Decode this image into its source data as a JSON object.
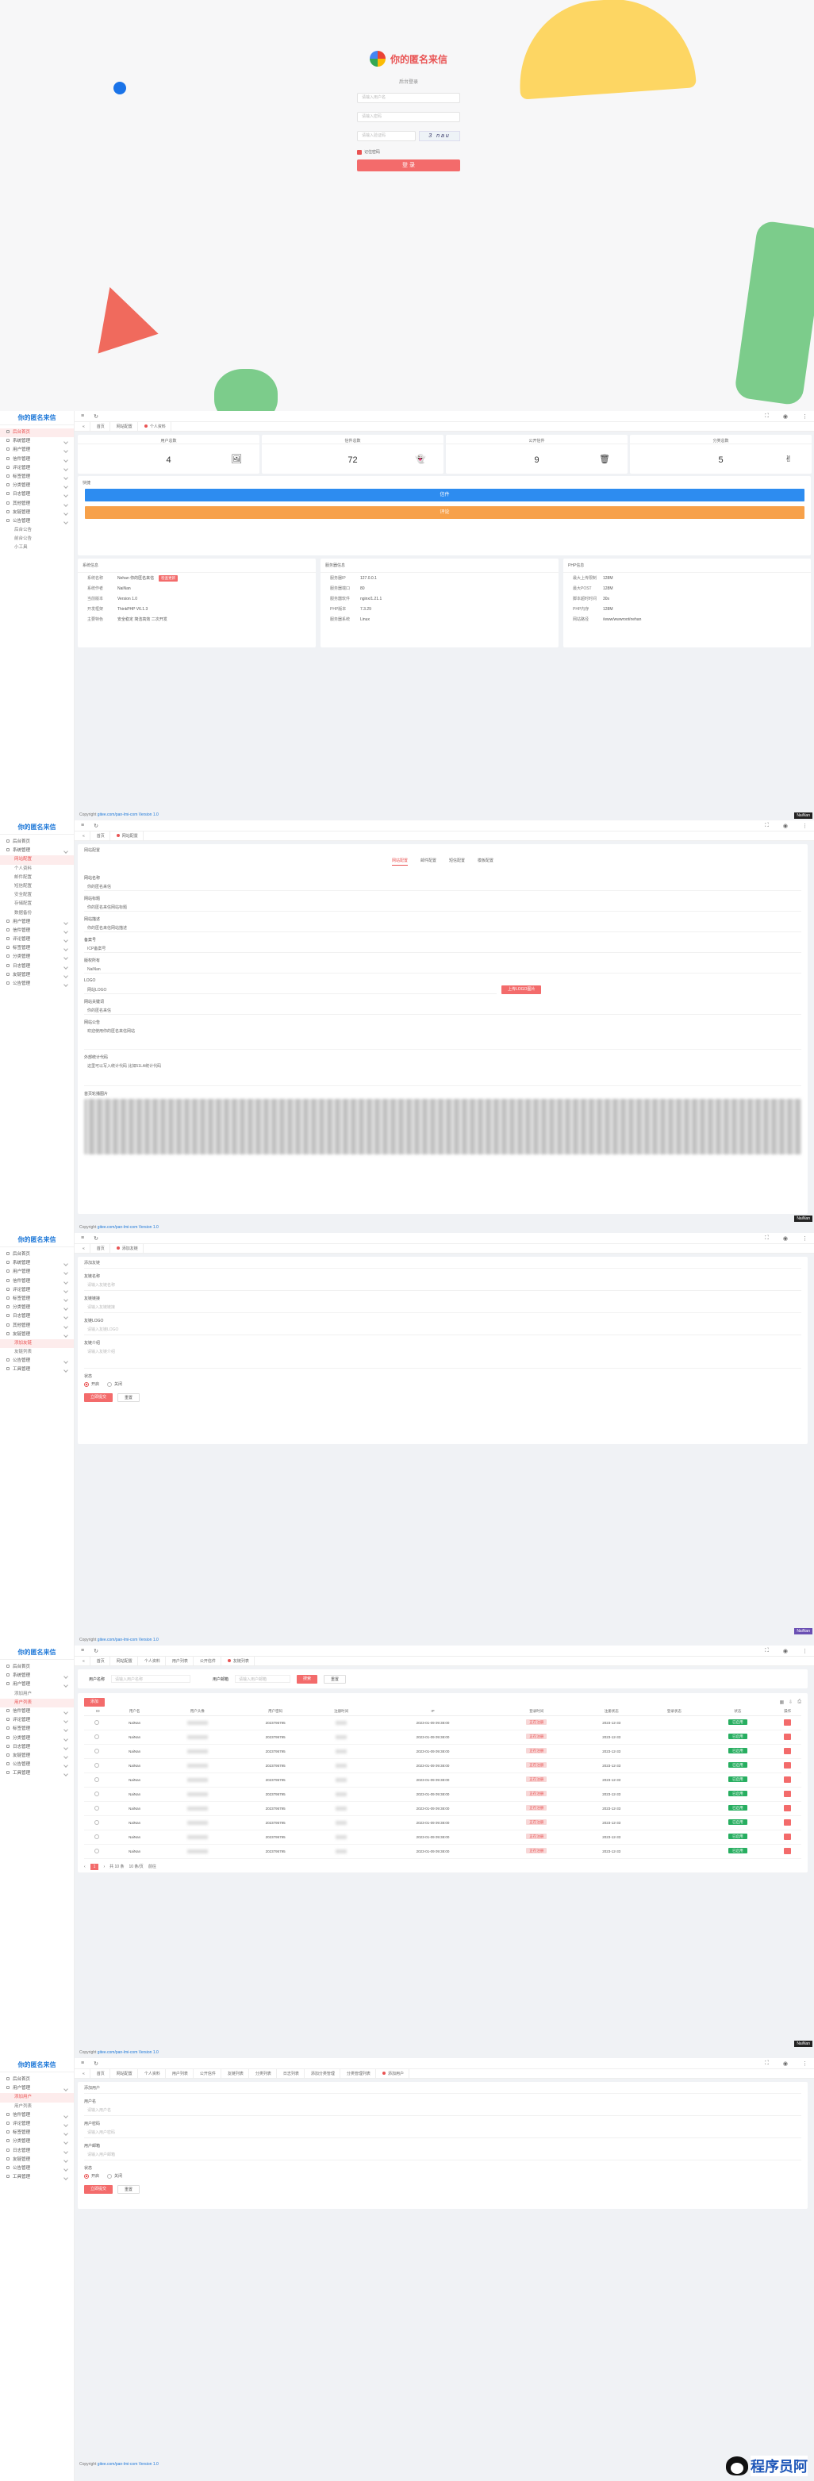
{
  "app": {
    "brand": "你的匿名来信",
    "copyright_prefix": "Copyright",
    "copyright_link": "gitee.com/pan-lmi-com",
    "copyright_version": "Version 1.0"
  },
  "login": {
    "title": "你的匿名来信",
    "subtitle": "后台登录",
    "username_placeholder": "请输入用户名",
    "password_placeholder": "请输入密码",
    "captcha_placeholder": "请输入验证码",
    "captcha_text": "3 nau",
    "remember": "记住密码",
    "submit": "登 录"
  },
  "menu_dashboard": [
    {
      "label": "后台首页",
      "active": true
    },
    {
      "label": "系统管理",
      "open": true
    },
    {
      "label": "用户管理",
      "open": true
    },
    {
      "label": "信件管理",
      "open": true
    },
    {
      "label": "评论管理",
      "open": true
    },
    {
      "label": "标签管理",
      "open": true
    },
    {
      "label": "分类管理",
      "open": true
    },
    {
      "label": "日志管理",
      "open": true
    },
    {
      "label": "其他管理",
      "open": true
    },
    {
      "label": "友链管理",
      "open": true
    },
    {
      "label": "公告管理",
      "open": true
    },
    {
      "label": "后台公告",
      "sub": true
    },
    {
      "label": "前台公告",
      "sub": true
    },
    {
      "label": "小工具",
      "sub": true
    }
  ],
  "menu_settings": [
    {
      "label": "后台首页"
    },
    {
      "label": "系统管理",
      "open": true
    },
    {
      "label": "网站配置",
      "sub": true,
      "active": true
    },
    {
      "label": "个人资料",
      "sub": true
    },
    {
      "label": "邮件配置",
      "sub": true
    },
    {
      "label": "短信配置",
      "sub": true
    },
    {
      "label": "安全配置",
      "sub": true
    },
    {
      "label": "存储配置",
      "sub": true
    },
    {
      "label": "数据备份",
      "sub": true
    },
    {
      "label": "用户管理",
      "open": true
    },
    {
      "label": "信件管理",
      "open": true
    },
    {
      "label": "评论管理",
      "open": true
    },
    {
      "label": "标签管理",
      "open": true
    },
    {
      "label": "分类管理",
      "open": true
    },
    {
      "label": "日志管理",
      "open": true
    },
    {
      "label": "友链管理",
      "open": true
    },
    {
      "label": "公告管理",
      "open": true
    }
  ],
  "menu_addlink": [
    {
      "label": "后台首页"
    },
    {
      "label": "系统管理",
      "open": true
    },
    {
      "label": "用户管理",
      "open": true
    },
    {
      "label": "信件管理",
      "open": true
    },
    {
      "label": "评论管理",
      "open": true
    },
    {
      "label": "标签管理",
      "open": true
    },
    {
      "label": "分类管理",
      "open": true
    },
    {
      "label": "日志管理",
      "open": true
    },
    {
      "label": "其他管理",
      "open": true
    },
    {
      "label": "友链管理",
      "open": true
    },
    {
      "label": "添加友链",
      "sub": true,
      "active": true
    },
    {
      "label": "友链列表",
      "sub": true
    },
    {
      "label": "公告管理",
      "open": true
    },
    {
      "label": "工具管理",
      "open": true
    }
  ],
  "menu_users": [
    {
      "label": "后台首页"
    },
    {
      "label": "系统管理",
      "open": true
    },
    {
      "label": "用户管理",
      "open": true
    },
    {
      "label": "添加用户",
      "sub": true
    },
    {
      "label": "用户列表",
      "sub": true,
      "active": true
    },
    {
      "label": "信件管理",
      "open": true
    },
    {
      "label": "评论管理",
      "open": true
    },
    {
      "label": "标签管理",
      "open": true
    },
    {
      "label": "分类管理",
      "open": true
    },
    {
      "label": "日志管理",
      "open": true
    },
    {
      "label": "友链管理",
      "open": true
    },
    {
      "label": "公告管理",
      "open": true
    },
    {
      "label": "工具管理",
      "open": true
    }
  ],
  "menu_adduser": [
    {
      "label": "后台首页"
    },
    {
      "label": "用户管理",
      "open": true
    },
    {
      "label": "添加用户",
      "sub": true,
      "active": true
    },
    {
      "label": "用户列表",
      "sub": true
    },
    {
      "label": "信件管理",
      "open": true
    },
    {
      "label": "评论管理",
      "open": true
    },
    {
      "label": "标签管理",
      "open": true
    },
    {
      "label": "分类管理",
      "open": true
    },
    {
      "label": "日志管理",
      "open": true
    },
    {
      "label": "友链管理",
      "open": true
    },
    {
      "label": "公告管理",
      "open": true
    },
    {
      "label": "工具管理",
      "open": true
    }
  ],
  "dashboard": {
    "tabs": [
      "首页",
      "网站配置",
      "个人资料"
    ],
    "stats": [
      {
        "title": "用户总数",
        "value": "4",
        "icon": "🖼"
      },
      {
        "title": "信件总数",
        "value": "72",
        "icon": "👻"
      },
      {
        "title": "公开信件",
        "value": "9",
        "icon": "🗑"
      },
      {
        "title": "分类总数",
        "value": "5",
        "icon": "✌"
      }
    ],
    "notice_title": "快捷",
    "btn_blue": "信件",
    "btn_orange": "评论",
    "sys_title": "系统信息",
    "sys_rows": [
      {
        "k": "系统名称",
        "v": "Nehan 你的匿名来信",
        "badge": "检查更新"
      },
      {
        "k": "系统作者",
        "v": "NaiNan"
      },
      {
        "k": "当前版本",
        "v": "Version 1.0"
      },
      {
        "k": "开发框架",
        "v": "ThinkPHP V6.1.3"
      },
      {
        "k": "主要特色",
        "v": "安全稳定 简洁高效 二次开发"
      }
    ],
    "server_title": "服务器信息",
    "server_rows": [
      {
        "k": "服务器IP",
        "v": "127.0.0.1"
      },
      {
        "k": "服务器端口",
        "v": "80"
      },
      {
        "k": "服务器软件",
        "v": "nginx/1.21.1"
      },
      {
        "k": "PHP版本",
        "v": "7.3.29"
      },
      {
        "k": "服务器系统",
        "v": "Linux"
      }
    ],
    "php_title": "PHP信息",
    "php_rows": [
      {
        "k": "最大上传限制",
        "v": "128M"
      },
      {
        "k": "最大POST",
        "v": "128M"
      },
      {
        "k": "脚本超时时间",
        "v": "30s"
      },
      {
        "k": "PHP内存",
        "v": "128M"
      },
      {
        "k": "网站路径",
        "v": "/www/wwwroot/nehan"
      }
    ]
  },
  "settings": {
    "tabs": [
      "首页",
      "网站配置"
    ],
    "card_title": "网站配置",
    "seg": [
      "网站配置",
      "邮件配置",
      "短信配置",
      "模板配置"
    ],
    "fields": [
      {
        "label": "网站名称",
        "value": "你的匿名来信"
      },
      {
        "label": "网站标题",
        "value": "你的匿名来信网站标题"
      },
      {
        "label": "网站描述",
        "value": "你的匿名来信网站描述"
      },
      {
        "label": "备案号",
        "value": "ICP备案号"
      },
      {
        "label": "版权所有",
        "value": "NaiNan"
      }
    ],
    "logo_label": "LOGO",
    "logo_value": "网站LOGO",
    "logo_btn": "上传LOGO图片",
    "kw_label": "网站关键词",
    "kw_value": "你的匿名来信",
    "footer_label": "网站公告",
    "footer_value": "欢迎使用你的匿名来信网站",
    "stat_label": "外部统计代码",
    "stat_value": "这里可以写入统计代码 比如51LA统计代码",
    "blur_label": "首页轮播图片"
  },
  "addlink": {
    "tabs": [
      "首页",
      "添加友链"
    ],
    "card_title": "添加友链",
    "fields": [
      {
        "label": "友链名称",
        "ph": "请输入友链名称"
      },
      {
        "label": "友链链接",
        "ph": "请输入友链链接"
      },
      {
        "label": "友链LOGO",
        "ph": "请输入友链LOGO"
      },
      {
        "label": "友链介绍",
        "ph": "请输入友链介绍"
      }
    ],
    "status_label": "状态",
    "on": "开启",
    "off": "关闭",
    "submit": "立即提交",
    "reset": "重置"
  },
  "users": {
    "tabs": [
      "首页",
      "网站配置",
      "个人资料",
      "用户列表",
      "公开信件",
      "友链列表"
    ],
    "search_label_1": "用户名称",
    "search_ph_1": "请输入用户名称",
    "search_label_2": "用户邮箱",
    "search_ph_2": "请输入用户邮箱",
    "search_btn": "搜索",
    "reset_btn": "重置",
    "add_btn": "添加",
    "headers": [
      "ID",
      "用户名",
      "用户头像",
      "用户密码",
      "注册时间",
      "IP",
      "登录时间",
      "注册状态",
      "登录状态",
      "状态",
      "操作"
    ],
    "rows": [
      {
        "id": "",
        "name": "NaiNan",
        "pwd": "2023795795",
        "time": "2023-01-09 09:38:00",
        "reg": "正在注册",
        "login": "2023-12-33",
        "status": "已启用"
      },
      {
        "id": "",
        "name": "NaiNan",
        "pwd": "2023795795",
        "time": "2023-01-09 09:38:00",
        "reg": "正在注册",
        "login": "2023-12-33",
        "status": "已启用"
      },
      {
        "id": "",
        "name": "NaiNan",
        "pwd": "2023795795",
        "time": "2023-01-09 09:38:00",
        "reg": "正在注册",
        "login": "2023-12-33",
        "status": "已启用"
      },
      {
        "id": "",
        "name": "NaiNan",
        "pwd": "2023795795",
        "time": "2023-01-09 09:38:00",
        "reg": "正在注册",
        "login": "2023-12-33",
        "status": "已启用"
      },
      {
        "id": "",
        "name": "NaiNan",
        "pwd": "2023795795",
        "time": "2023-01-09 09:38:00",
        "reg": "正在注册",
        "login": "2023-12-33",
        "status": "已启用"
      },
      {
        "id": "",
        "name": "NaiNan",
        "pwd": "2023795795",
        "time": "2023-01-09 09:38:00",
        "reg": "正在注册",
        "login": "2023-12-33",
        "status": "已启用"
      },
      {
        "id": "",
        "name": "NaiNan",
        "pwd": "2023795795",
        "time": "2023-01-09 09:38:00",
        "reg": "正在注册",
        "login": "2023-12-33",
        "status": "已启用"
      },
      {
        "id": "",
        "name": "NaiNan",
        "pwd": "2023795795",
        "time": "2023-01-09 09:38:00",
        "reg": "正在注册",
        "login": "2023-12-33",
        "status": "已启用"
      },
      {
        "id": "",
        "name": "NaiNan",
        "pwd": "2023795795",
        "time": "2023-01-09 09:38:00",
        "reg": "正在注册",
        "login": "2023-12-33",
        "status": "已启用"
      },
      {
        "id": "",
        "name": "NaiNan",
        "pwd": "2023795795",
        "time": "2023-01-09 09:38:00",
        "reg": "正在注册",
        "login": "2023-12-33",
        "status": "已启用"
      }
    ],
    "pager": "共 10 条",
    "page": "1",
    "page_size": "10 条/页",
    "goto": "前往"
  },
  "adduser": {
    "tabs": [
      "首页",
      "网站配置",
      "个人资料",
      "用户列表",
      "公开信件",
      "友链列表",
      "分类列表",
      "日志列表",
      "添加分类管理",
      "分类管理列表",
      "添加用户"
    ],
    "card_title": "添加用户",
    "fields": [
      {
        "label": "用户名",
        "ph": "请输入用户名"
      },
      {
        "label": "用户密码",
        "ph": "请输入用户密码"
      },
      {
        "label": "用户邮箱",
        "ph": "请输入用户邮箱"
      }
    ],
    "status_label": "状态",
    "on": "开启",
    "off": "关闭",
    "submit": "立即提交",
    "reset": "重置"
  },
  "watermark": "NaiNan",
  "footer_logo": "程序员阿",
  "colors": {
    "accent": "#e95353",
    "blue": "#2d8cf0",
    "orange": "#f7a14a",
    "green": "#27ae60"
  }
}
